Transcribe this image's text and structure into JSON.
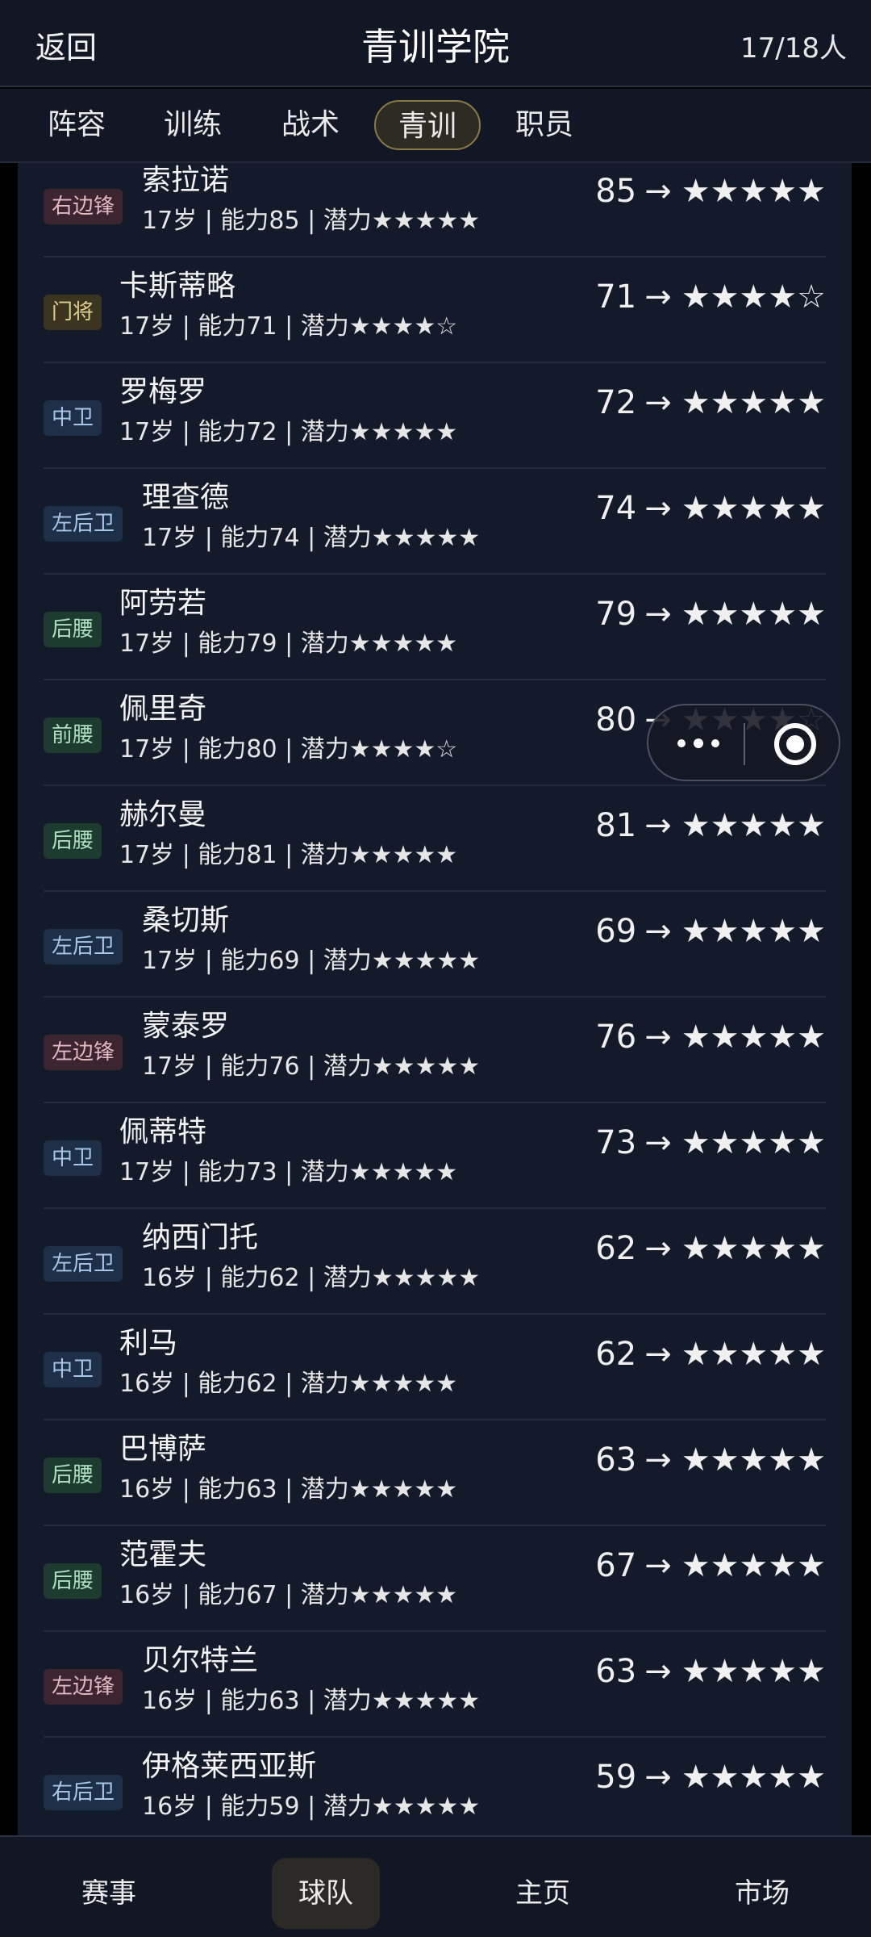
{
  "header": {
    "back_label": "返回",
    "title": "青训学院",
    "count": "17/18人"
  },
  "tabs": [
    {
      "label": "阵容",
      "active": false
    },
    {
      "label": "训练",
      "active": false
    },
    {
      "label": "战术",
      "active": false
    },
    {
      "label": "青训",
      "active": true
    },
    {
      "label": "职员",
      "active": false
    }
  ],
  "players": [
    {
      "position": "右边锋",
      "name": "索拉诺",
      "info": "17岁 | 能力85 | 潜力★★★★★",
      "rating": "85",
      "arrow": "→",
      "stars": "★★★★★"
    },
    {
      "position": "门将",
      "name": "卡斯蒂略",
      "info": "17岁 | 能力71 | 潜力★★★★☆",
      "rating": "71",
      "arrow": "→",
      "stars": "★★★★☆"
    },
    {
      "position": "中卫",
      "name": "罗梅罗",
      "info": "17岁 | 能力72 | 潜力★★★★★",
      "rating": "72",
      "arrow": "→",
      "stars": "★★★★★"
    },
    {
      "position": "左后卫",
      "name": "理查德",
      "info": "17岁 | 能力74 | 潜力★★★★★",
      "rating": "74",
      "arrow": "→",
      "stars": "★★★★★"
    },
    {
      "position": "后腰",
      "name": "阿劳若",
      "info": "17岁 | 能力79 | 潜力★★★★★",
      "rating": "79",
      "arrow": "→",
      "stars": "★★★★★"
    },
    {
      "position": "前腰",
      "name": "佩里奇",
      "info": "17岁 | 能力80 | 潜力★★★★☆",
      "rating": "80",
      "arrow": "→",
      "stars": "★★★★☆"
    },
    {
      "position": "后腰",
      "name": "赫尔曼",
      "info": "17岁 | 能力81 | 潜力★★★★★",
      "rating": "81",
      "arrow": "→",
      "stars": "★★★★★"
    },
    {
      "position": "左后卫",
      "name": "桑切斯",
      "info": "17岁 | 能力69 | 潜力★★★★★",
      "rating": "69",
      "arrow": "→",
      "stars": "★★★★★"
    },
    {
      "position": "左边锋",
      "name": "蒙泰罗",
      "info": "17岁 | 能力76 | 潜力★★★★★",
      "rating": "76",
      "arrow": "→",
      "stars": "★★★★★"
    },
    {
      "position": "中卫",
      "name": "佩蒂特",
      "info": "17岁 | 能力73 | 潜力★★★★★",
      "rating": "73",
      "arrow": "→",
      "stars": "★★★★★"
    },
    {
      "position": "左后卫",
      "name": "纳西门托",
      "info": "16岁 | 能力62 | 潜力★★★★★",
      "rating": "62",
      "arrow": "→",
      "stars": "★★★★★"
    },
    {
      "position": "中卫",
      "name": "利马",
      "info": "16岁 | 能力62 | 潜力★★★★★",
      "rating": "62",
      "arrow": "→",
      "stars": "★★★★★"
    },
    {
      "position": "后腰",
      "name": "巴博萨",
      "info": "16岁 | 能力63 | 潜力★★★★★",
      "rating": "63",
      "arrow": "→",
      "stars": "★★★★★"
    },
    {
      "position": "后腰",
      "name": "范霍夫",
      "info": "16岁 | 能力67 | 潜力★★★★★",
      "rating": "67",
      "arrow": "→",
      "stars": "★★★★★"
    },
    {
      "position": "左边锋",
      "name": "贝尔特兰",
      "info": "16岁 | 能力63 | 潜力★★★★★",
      "rating": "63",
      "arrow": "→",
      "stars": "★★★★★"
    },
    {
      "position": "右后卫",
      "name": "伊格莱西亚斯",
      "info": "16岁 | 能力59 | 潜力★★★★★",
      "rating": "59",
      "arrow": "→",
      "stars": "★★★★★"
    }
  ],
  "capsule": {
    "more_icon": "more-dots-icon",
    "close_icon": "target-icon"
  },
  "bottom_nav": [
    {
      "label": "赛事",
      "active": false
    },
    {
      "label": "球队",
      "active": true
    },
    {
      "label": "主页",
      "active": false
    },
    {
      "label": "市场",
      "active": false
    }
  ]
}
